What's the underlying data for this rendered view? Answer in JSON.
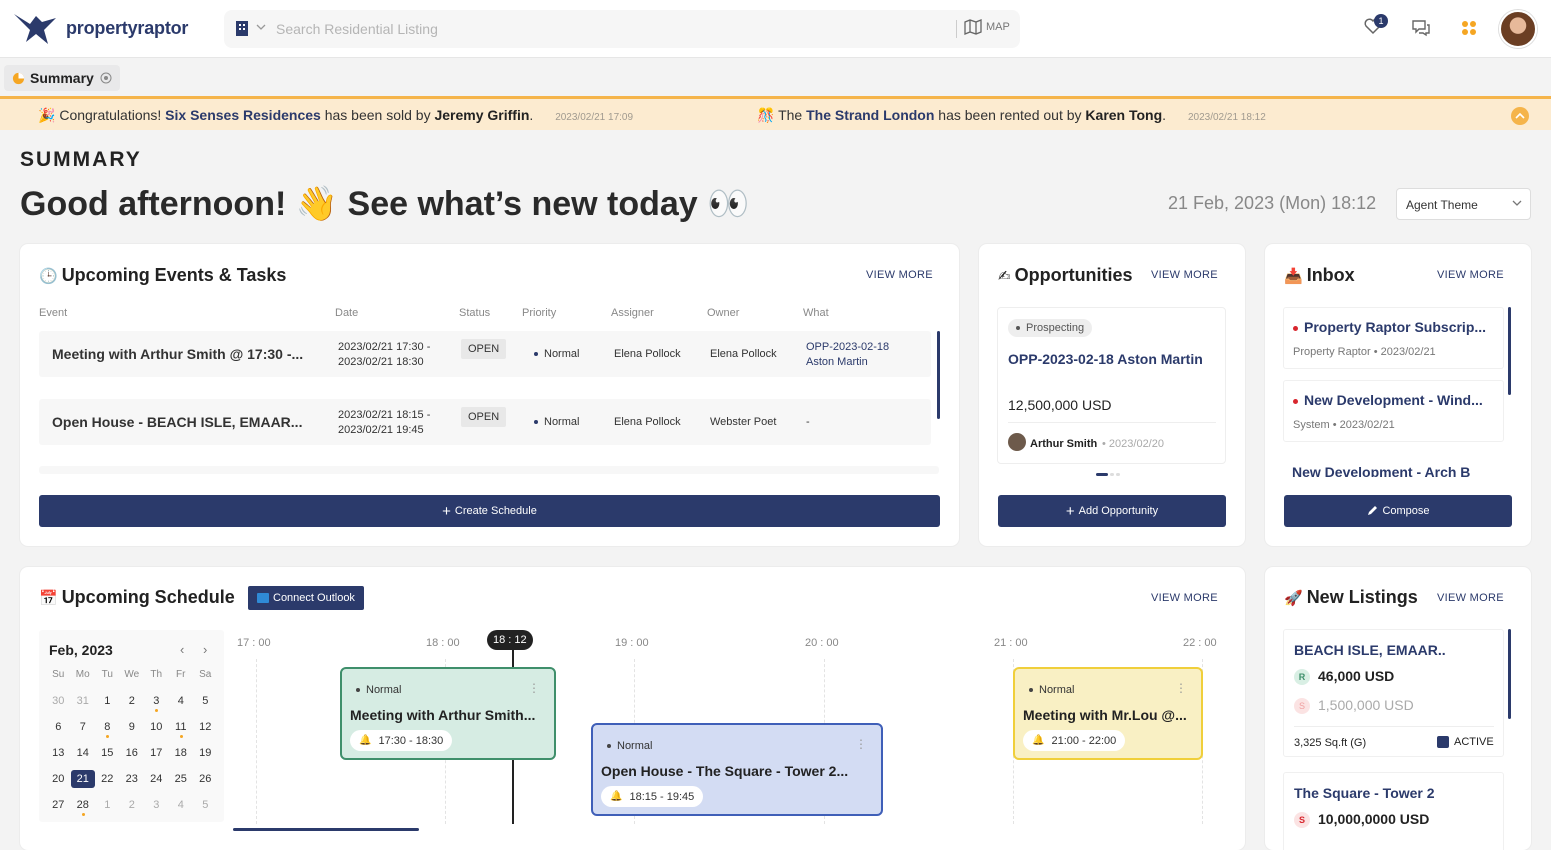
{
  "topbar": {
    "logo_text": "propertyraptor",
    "search_placeholder": "Search Residential Listing",
    "map_label": "MAP",
    "notification_count": "1"
  },
  "tab": {
    "label": "Summary"
  },
  "banner": {
    "n1": {
      "prefix": "Congratulations! ",
      "property": "Six Senses Residences",
      "middle": " has been sold by ",
      "person": "Jeremy Griffin",
      "suffix": ".",
      "timestamp": "2023/02/21 17:09"
    },
    "n2": {
      "prefix": "The ",
      "property": "The Strand London",
      "middle": " has been rented out by ",
      "person": "Karen Tong",
      "suffix": ".",
      "timestamp": "2023/02/21 18:12"
    }
  },
  "header": {
    "page_label": "SUMMARY",
    "greeting": "Good afternoon! 👋 See what’s new today 👀",
    "datetime": "21 Feb, 2023 (Mon) 18:12",
    "theme": "Agent Theme"
  },
  "events": {
    "title": "Upcoming Events & Tasks",
    "view_more": "VIEW MORE",
    "columns": [
      "Event",
      "Date",
      "Status",
      "Priority",
      "Assigner",
      "Owner",
      "What"
    ],
    "rows": [
      {
        "event": "Meeting with Arthur Smith @ 17:30 -...",
        "date1": "2023/02/21 17:30 -",
        "date2": "2023/02/21 18:30",
        "status": "OPEN",
        "priority": "Normal",
        "assigner": "Elena Pollock",
        "owner": "Elena Pollock",
        "what1": "OPP-2023-02-18",
        "what2": "Aston Martin"
      },
      {
        "event": "Open House - BEACH ISLE, EMAAR...",
        "date1": "2023/02/21 18:15 -",
        "date2": "2023/02/21 19:45",
        "status": "OPEN",
        "priority": "Normal",
        "assigner": "Elena Pollock",
        "owner": "Webster Poet",
        "what1": "-",
        "what2": ""
      }
    ],
    "button": "Create Schedule"
  },
  "opportunities": {
    "title": "Opportunities",
    "view_more": "VIEW MORE",
    "stage": "Prospecting",
    "name": "OPP-2023-02-18 Aston Martin",
    "amount": "12,500,000 USD",
    "person": "Arthur Smith",
    "date": "2023/02/20",
    "button": "Add Opportunity"
  },
  "inbox": {
    "title": "Inbox",
    "view_more": "VIEW MORE",
    "items": [
      {
        "title": "Property Raptor Subscrip...",
        "from": "Property Raptor",
        "date": "2023/02/21"
      },
      {
        "title": "New Development - Wind...",
        "from": "System",
        "date": "2023/02/21"
      },
      {
        "title": "New Development - Arch B",
        "from": "",
        "date": ""
      }
    ],
    "button": "Compose"
  },
  "schedule": {
    "title": "Upcoming Schedule",
    "outlook": "Connect Outlook",
    "view_more": "VIEW MORE",
    "calendar": {
      "month": "Feb, 2023",
      "weekdays": [
        "Su",
        "Mo",
        "Tu",
        "We",
        "Th",
        "Fr",
        "Sa"
      ],
      "days": [
        "30",
        "31",
        "1",
        "2",
        "3",
        "4",
        "5",
        "6",
        "7",
        "8",
        "9",
        "10",
        "11",
        "12",
        "13",
        "14",
        "15",
        "16",
        "17",
        "18",
        "19",
        "20",
        "21",
        "22",
        "23",
        "24",
        "25",
        "26",
        "27",
        "28",
        "1",
        "2",
        "3",
        "4",
        "5"
      ]
    },
    "hours": [
      "17 : 00",
      "18 : 00",
      "19 : 00",
      "20 : 00",
      "21 : 00",
      "22 : 00"
    ],
    "now": "18 : 12",
    "items": [
      {
        "priority": "Normal",
        "title": "Meeting with Arthur Smith...",
        "time": "17:30 - 18:30"
      },
      {
        "priority": "Normal",
        "title": "Open House - The Square - Tower 2...",
        "time": "18:15 - 19:45"
      },
      {
        "priority": "Normal",
        "title": "Meeting with Mr.Lou @...",
        "time": "21:00 - 22:00"
      }
    ]
  },
  "listings": {
    "title": "New Listings",
    "view_more": "VIEW MORE",
    "items": [
      {
        "name": "BEACH ISLE, EMAAR..",
        "rent_badge": "R",
        "rent": "46,000 USD",
        "sale_badge": "S",
        "sale": "1,500,000 USD",
        "area": "3,325 Sq.ft (G)",
        "status": "ACTIVE"
      },
      {
        "name": "The Square - Tower 2",
        "sale_badge": "S",
        "sale": "10,000,0000 USD"
      }
    ]
  }
}
